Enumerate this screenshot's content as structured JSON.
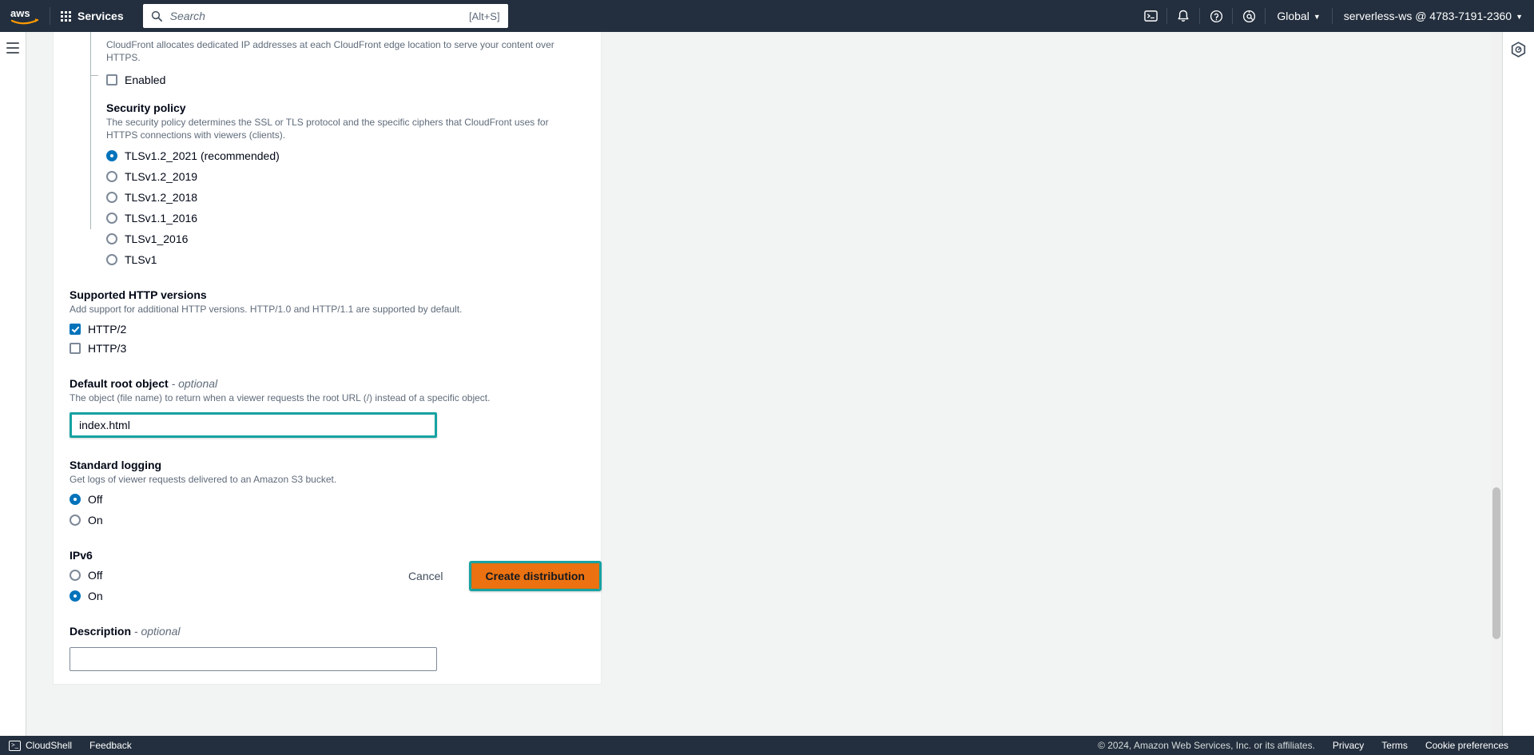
{
  "topnav": {
    "logo_alt": "aws",
    "services_label": "Services",
    "search_placeholder": "Search",
    "search_value": "",
    "search_hotkey": "[Alt+S]",
    "icons": [
      "cloudshell-icon",
      "notifications-icon",
      "help-icon",
      "settings-icon"
    ],
    "region_label": "Global",
    "account_label": "serverless-ws @ 4783-7191-2360"
  },
  "right_rail": {
    "help_panel_icon": "info-hexagon-icon"
  },
  "form": {
    "dedicated_ip": {
      "description": "CloudFront allocates dedicated IP addresses at each CloudFront edge location to serve your content over HTTPS.",
      "checkbox_label": "Enabled",
      "checked": false
    },
    "security_policy": {
      "title": "Security policy",
      "description": "The security policy determines the SSL or TLS protocol and the specific ciphers that CloudFront uses for HTTPS connections with viewers (clients).",
      "options": [
        {
          "label": "TLSv1.2_2021 (recommended)",
          "selected": true
        },
        {
          "label": "TLSv1.2_2019",
          "selected": false
        },
        {
          "label": "TLSv1.2_2018",
          "selected": false
        },
        {
          "label": "TLSv1.1_2016",
          "selected": false
        },
        {
          "label": "TLSv1_2016",
          "selected": false
        },
        {
          "label": "TLSv1",
          "selected": false
        }
      ]
    },
    "http_versions": {
      "title": "Supported HTTP versions",
      "description": "Add support for additional HTTP versions. HTTP/1.0 and HTTP/1.1 are supported by default.",
      "options": [
        {
          "label": "HTTP/2",
          "checked": true
        },
        {
          "label": "HTTP/3",
          "checked": false
        }
      ]
    },
    "default_root_object": {
      "label": "Default root object",
      "optional_suffix": "- optional",
      "description": "The object (file name) to return when a viewer requests the root URL (/) instead of a specific object.",
      "value": "index.html",
      "placeholder": "",
      "highlighted": true,
      "highlight_color": "#17a2a2"
    },
    "standard_logging": {
      "title": "Standard logging",
      "description": "Get logs of viewer requests delivered to an Amazon S3 bucket.",
      "options": [
        {
          "label": "Off",
          "selected": true
        },
        {
          "label": "On",
          "selected": false
        }
      ]
    },
    "ipv6": {
      "title": "IPv6",
      "description": "",
      "options": [
        {
          "label": "Off",
          "selected": false
        },
        {
          "label": "On",
          "selected": true
        }
      ]
    },
    "description_field": {
      "label": "Description",
      "optional_suffix": "- optional",
      "value": "",
      "placeholder": ""
    }
  },
  "actions": {
    "cancel_label": "Cancel",
    "submit_label": "Create distribution",
    "submit_color": "#ec7211",
    "submit_highlight_color": "#17a2a2"
  },
  "bottombar": {
    "cloudshell_label": "CloudShell",
    "feedback_label": "Feedback",
    "copyright": "© 2024, Amazon Web Services, Inc. or its affiliates.",
    "privacy_label": "Privacy",
    "terms_label": "Terms",
    "cookie_label": "Cookie preferences"
  }
}
